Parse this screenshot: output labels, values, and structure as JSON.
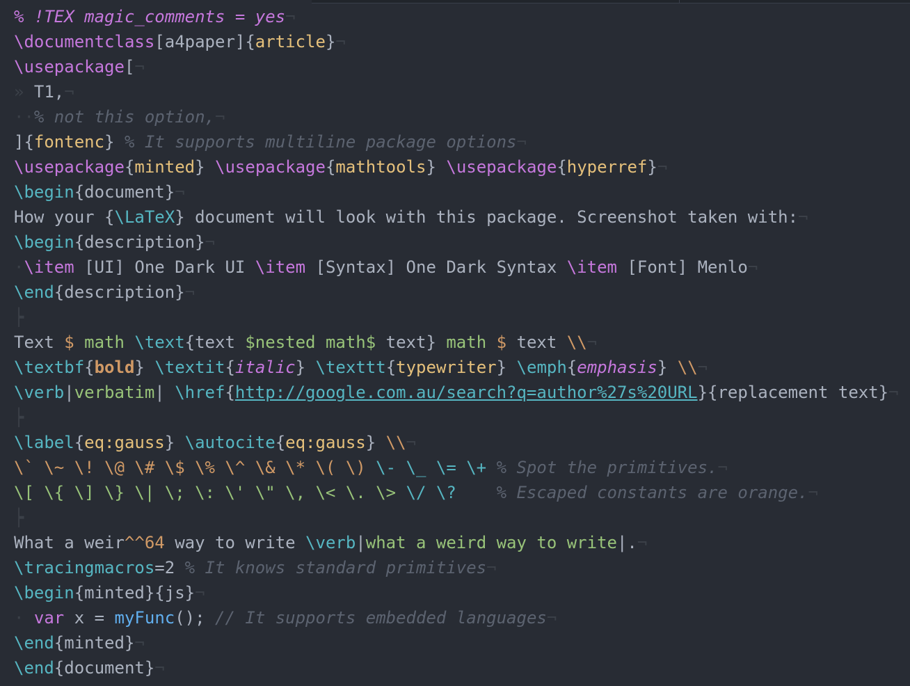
{
  "editor": {
    "syntax": "LaTeX",
    "theme": "One Dark",
    "font_hint": "Menlo",
    "colors": {
      "background": "#282c34",
      "comment": "#5c6370",
      "keyword": "#c678dd",
      "function": "#61afef",
      "string": "#98c379",
      "class": "#e5c07b",
      "constant": "#d19a66",
      "error": "#e06c75",
      "cyan": "#56b6c2",
      "text": "#abb2bf",
      "invisible": "#3b4048"
    },
    "invisibles": {
      "eol": "¬",
      "tab": "»",
      "space": "·",
      "fold": "┝"
    }
  },
  "lines": [
    [
      {
        "t": "% !TEX magic_comments = yes",
        "c": "magic"
      }
    ],
    [
      {
        "t": "\\documentclass",
        "c": "kw"
      },
      {
        "t": "[a4paper]{",
        "c": "txt"
      },
      {
        "t": "article",
        "c": "cls"
      },
      {
        "t": "}",
        "c": "txt"
      }
    ],
    [
      {
        "t": "\\usepackage",
        "c": "kw"
      },
      {
        "t": "[",
        "c": "txt"
      }
    ],
    [
      {
        "t": "» ",
        "c": "invis"
      },
      {
        "t": "T1,",
        "c": "txt"
      }
    ],
    [
      {
        "t": "··",
        "c": "invis"
      },
      {
        "t": "% not this option,",
        "c": "cm"
      }
    ],
    [
      {
        "t": "]{",
        "c": "txt"
      },
      {
        "t": "fontenc",
        "c": "cls"
      },
      {
        "t": "} ",
        "c": "txt"
      },
      {
        "t": "% It supports multiline package options",
        "c": "cm"
      }
    ],
    [
      {
        "t": "\\usepackage",
        "c": "kw"
      },
      {
        "t": "{",
        "c": "txt"
      },
      {
        "t": "minted",
        "c": "cls"
      },
      {
        "t": "} ",
        "c": "txt"
      },
      {
        "t": "\\usepackage",
        "c": "kw"
      },
      {
        "t": "{",
        "c": "txt"
      },
      {
        "t": "mathtools",
        "c": "cls"
      },
      {
        "t": "} ",
        "c": "txt"
      },
      {
        "t": "\\usepackage",
        "c": "kw"
      },
      {
        "t": "{",
        "c": "txt"
      },
      {
        "t": "hyperref",
        "c": "cls"
      },
      {
        "t": "}",
        "c": "txt"
      }
    ],
    [
      {
        "t": "\\begin",
        "c": "cyan"
      },
      {
        "t": "{document}",
        "c": "txt"
      }
    ],
    [
      {
        "t": "How your {",
        "c": "txt"
      },
      {
        "t": "\\LaTeX",
        "c": "cyan"
      },
      {
        "t": "} document will look with this package. Screenshot taken with:",
        "c": "txt"
      }
    ],
    [
      {
        "t": "\\begin",
        "c": "cyan"
      },
      {
        "t": "{description}",
        "c": "txt"
      }
    ],
    [
      {
        "t": "·",
        "c": "invis"
      },
      {
        "t": "\\item",
        "c": "kw"
      },
      {
        "t": " [UI] One Dark UI ",
        "c": "txt"
      },
      {
        "t": "\\item",
        "c": "kw"
      },
      {
        "t": " [Syntax] One Dark Syntax ",
        "c": "txt"
      },
      {
        "t": "\\item",
        "c": "kw"
      },
      {
        "t": " [Font] Menlo",
        "c": "txt"
      }
    ],
    [
      {
        "t": "\\end",
        "c": "cyan"
      },
      {
        "t": "{description}",
        "c": "txt"
      }
    ],
    [
      {
        "t": "┝",
        "c": "invis",
        "noeol": true
      }
    ],
    [
      {
        "t": "Text ",
        "c": "txt"
      },
      {
        "t": "$",
        "c": "org"
      },
      {
        "t": " math ",
        "c": "str"
      },
      {
        "t": "\\text",
        "c": "cyan"
      },
      {
        "t": "{text ",
        "c": "txt"
      },
      {
        "t": "$nested math$",
        "c": "str"
      },
      {
        "t": " text} ",
        "c": "txt"
      },
      {
        "t": "math ",
        "c": "str"
      },
      {
        "t": "$",
        "c": "org"
      },
      {
        "t": " text ",
        "c": "txt"
      },
      {
        "t": "\\\\",
        "c": "org"
      }
    ],
    [
      {
        "t": "\\textbf",
        "c": "cyan"
      },
      {
        "t": "{",
        "c": "txt"
      },
      {
        "t": "bold",
        "c": "org bd"
      },
      {
        "t": "} ",
        "c": "txt"
      },
      {
        "t": "\\textit",
        "c": "cyan"
      },
      {
        "t": "{",
        "c": "txt"
      },
      {
        "t": "italic",
        "c": "kw it"
      },
      {
        "t": "} ",
        "c": "txt"
      },
      {
        "t": "\\texttt",
        "c": "cyan"
      },
      {
        "t": "{",
        "c": "txt"
      },
      {
        "t": "typewriter",
        "c": "cls"
      },
      {
        "t": "} ",
        "c": "txt"
      },
      {
        "t": "\\emph",
        "c": "cyan"
      },
      {
        "t": "{",
        "c": "txt"
      },
      {
        "t": "emphasis",
        "c": "kw it"
      },
      {
        "t": "} ",
        "c": "txt"
      },
      {
        "t": "\\\\",
        "c": "org"
      }
    ],
    [
      {
        "t": "\\verb",
        "c": "cyan"
      },
      {
        "t": "|",
        "c": "txt"
      },
      {
        "t": "verbatim",
        "c": "str"
      },
      {
        "t": "| ",
        "c": "txt"
      },
      {
        "t": "\\href",
        "c": "cyan"
      },
      {
        "t": "{",
        "c": "txt"
      },
      {
        "t": "http://google.com.au/search?q=author%27s%20URL",
        "c": "url"
      },
      {
        "t": "}{replacement text}",
        "c": "txt"
      }
    ],
    [
      {
        "t": "┝",
        "c": "invis",
        "noeol": true
      }
    ],
    [
      {
        "t": "\\label",
        "c": "cyan"
      },
      {
        "t": "{",
        "c": "txt"
      },
      {
        "t": "eq:gauss",
        "c": "cls"
      },
      {
        "t": "} ",
        "c": "txt"
      },
      {
        "t": "\\autocite",
        "c": "cyan"
      },
      {
        "t": "{",
        "c": "txt"
      },
      {
        "t": "eq:gauss",
        "c": "cls"
      },
      {
        "t": "} ",
        "c": "txt"
      },
      {
        "t": "\\\\",
        "c": "org"
      }
    ],
    [
      {
        "t": "\\` \\~ \\! \\@ \\# \\$ \\% \\^ \\& \\* \\( \\)",
        "c": "org"
      },
      {
        "t": " \\- \\_ \\= \\+ ",
        "c": "cyan"
      },
      {
        "t": "% Spot the primitives.",
        "c": "cm"
      }
    ],
    [
      {
        "t": "\\[ \\{ \\] \\} \\| \\; \\: \\' \\\" \\, \\< \\. \\>",
        "c": "str"
      },
      {
        "t": " \\/ \\? ",
        "c": "cyan"
      },
      {
        "t": "   % Escaped constants are orange.",
        "c": "cm"
      }
    ],
    [
      {
        "t": "┝",
        "c": "invis",
        "noeol": true
      }
    ],
    [
      {
        "t": "What a weir",
        "c": "txt"
      },
      {
        "t": "^^64",
        "c": "org"
      },
      {
        "t": " way to write ",
        "c": "txt"
      },
      {
        "t": "\\verb",
        "c": "cyan"
      },
      {
        "t": "|",
        "c": "txt"
      },
      {
        "t": "what a weird way to write",
        "c": "str"
      },
      {
        "t": "|.",
        "c": "txt"
      }
    ],
    [
      {
        "t": "\\tracingmacros",
        "c": "cyan"
      },
      {
        "t": "=2 ",
        "c": "txt"
      },
      {
        "t": "% It knows standard primitives",
        "c": "cm"
      }
    ],
    [
      {
        "t": "\\begin",
        "c": "cyan"
      },
      {
        "t": "{minted}{js}",
        "c": "txt"
      }
    ],
    [
      {
        "t": "· ",
        "c": "invis"
      },
      {
        "t": "var",
        "c": "kw"
      },
      {
        "t": " x = ",
        "c": "txt"
      },
      {
        "t": "myFunc",
        "c": "fn"
      },
      {
        "t": "(); ",
        "c": "txt"
      },
      {
        "t": "// It supports embedded languages",
        "c": "cm"
      }
    ],
    [
      {
        "t": "\\end",
        "c": "cyan"
      },
      {
        "t": "{minted}",
        "c": "txt"
      }
    ],
    [
      {
        "t": "\\end",
        "c": "cyan"
      },
      {
        "t": "{document}",
        "c": "txt"
      }
    ]
  ]
}
